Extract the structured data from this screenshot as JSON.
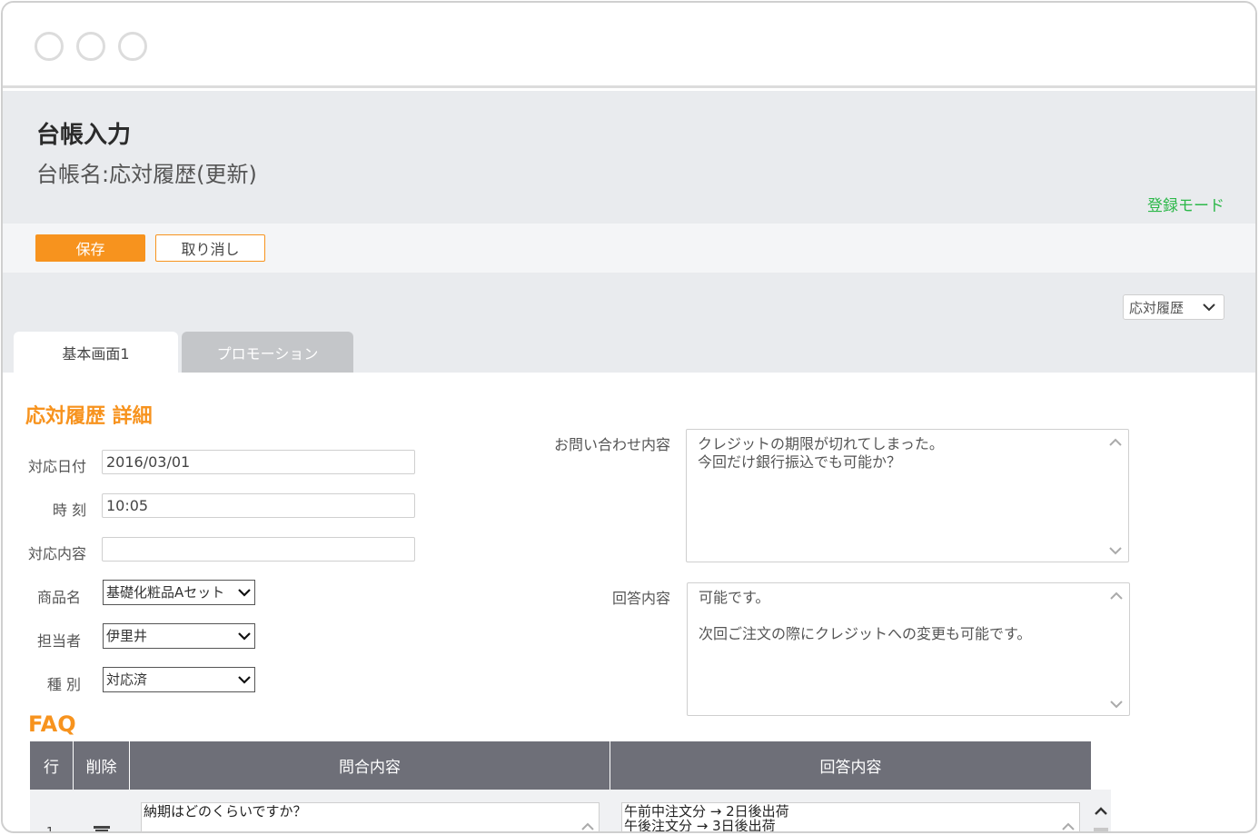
{
  "page": {
    "title": "台帳入力",
    "ledger_name": "台帳名:応対履歴(更新)",
    "mode": "登録モード"
  },
  "toolbar": {
    "save_label": "保存",
    "cancel_label": "取り消し"
  },
  "ledger_select": {
    "value": "応対履歴"
  },
  "tabs": [
    {
      "label": "基本画面1",
      "active": true
    },
    {
      "label": "プロモーション",
      "active": false
    }
  ],
  "detail": {
    "section_title": "応対履歴 詳細",
    "fields": {
      "date": {
        "label": "対応日付",
        "value": "2016/03/01"
      },
      "time": {
        "label": "時 刻",
        "value": "10:05"
      },
      "content": {
        "label": "対応内容",
        "value": ""
      },
      "product": {
        "label": "商品名",
        "value": "基礎化粧品Aセット"
      },
      "staff": {
        "label": "担当者",
        "value": "伊里井"
      },
      "kind": {
        "label": "種 別",
        "value": "対応済"
      },
      "inquiry": {
        "label": "お問い合わせ内容",
        "lines": [
          "クレジットの期限が切れてしまった。",
          "今回だけ銀行振込でも可能か？"
        ]
      },
      "answer": {
        "label": "回答内容",
        "lines": [
          "可能です。",
          "",
          "次回ご注文の際にクレジットへの変更も可能です。"
        ]
      }
    }
  },
  "faq": {
    "title": "FAQ",
    "columns": [
      "行",
      "削除",
      "問合内容",
      "回答内容"
    ],
    "rows": [
      {
        "row_no": "1",
        "question": "納期はどのくらいですか？",
        "answer_lines": [
          "午前中注文分 → 2日後出荷",
          "午後注文分 → 3日後出荷"
        ]
      }
    ]
  },
  "colors": {
    "accent_orange": "#f7931e",
    "mode_green": "#2db84a",
    "header_gray": "#e9ebee",
    "table_header": "#6e6f78"
  },
  "icons": {
    "dropdown": "chevron-down-icon",
    "scroll_up": "chevron-up-icon",
    "scroll_down": "chevron-down-icon",
    "delete": "trash-icon"
  }
}
